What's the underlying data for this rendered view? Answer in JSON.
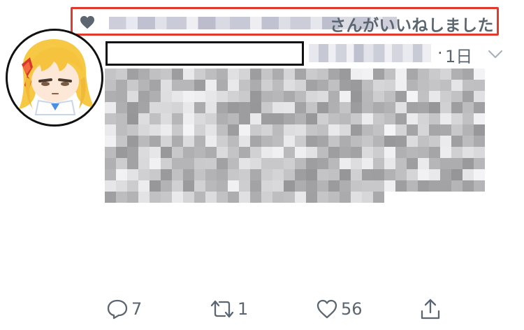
{
  "social_context": {
    "text": "さんがいいねしました",
    "icon": "heart-filled-icon"
  },
  "tweet": {
    "time": "1日",
    "time_separator": "·"
  },
  "actions": {
    "reply": {
      "icon": "reply-icon",
      "count": "7"
    },
    "retweet": {
      "icon": "retweet-icon",
      "count": "1"
    },
    "like": {
      "icon": "heart-outline-icon",
      "count": "56"
    },
    "share": {
      "icon": "share-icon"
    }
  },
  "colors": {
    "highlight_border": "#e23b2e",
    "secondary_text": "#5b6670",
    "icon_gray": "#5b6670"
  }
}
